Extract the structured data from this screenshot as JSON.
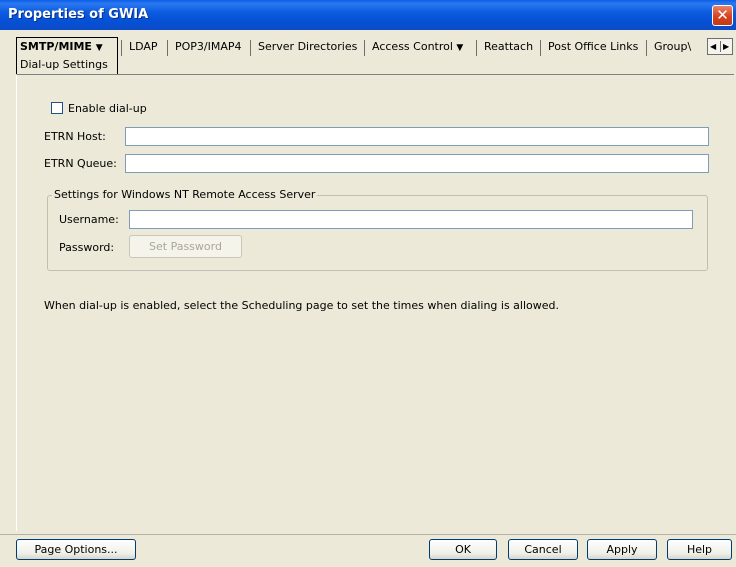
{
  "window": {
    "title": "Properties of GWIA",
    "close_glyph": "✕"
  },
  "tabs": {
    "active": {
      "label": "SMTP/MIME",
      "sub_label": "Dial-up Settings"
    },
    "items": [
      {
        "label": "LDAP"
      },
      {
        "label": "POP3/IMAP4"
      },
      {
        "label": "Server Directories"
      },
      {
        "label": "Access Control",
        "has_menu": true
      },
      {
        "label": "Reattach"
      },
      {
        "label": "Post Office Links"
      },
      {
        "label": "Group\\"
      }
    ],
    "dropdown_glyph": "▼",
    "scroll_left": "◀",
    "scroll_right": "▶"
  },
  "form": {
    "enable_dialup_label": "Enable dial-up",
    "enable_dialup_checked": false,
    "etrn_host_label": "ETRN Host:",
    "etrn_host_value": "",
    "etrn_queue_label": "ETRN Queue:",
    "etrn_queue_value": "",
    "group_title": "Settings for Windows NT Remote Access Server",
    "username_label": "Username:",
    "username_value": "",
    "password_label": "Password:",
    "set_password_button": "Set Password",
    "info_text": "When dial-up is enabled, select the Scheduling page to set the times when dialing is allowed."
  },
  "buttons": {
    "page_options": "Page Options...",
    "ok": "OK",
    "cancel": "Cancel",
    "apply": "Apply",
    "help": "Help"
  },
  "colors": {
    "titlebar": "#0a5ee8",
    "window_bg": "#ece9d8",
    "close": "#d6421f"
  },
  "icons": [
    "close-icon",
    "dropdown-caret-icon",
    "scroll-left-icon",
    "scroll-right-icon",
    "checkbox-icon"
  ]
}
